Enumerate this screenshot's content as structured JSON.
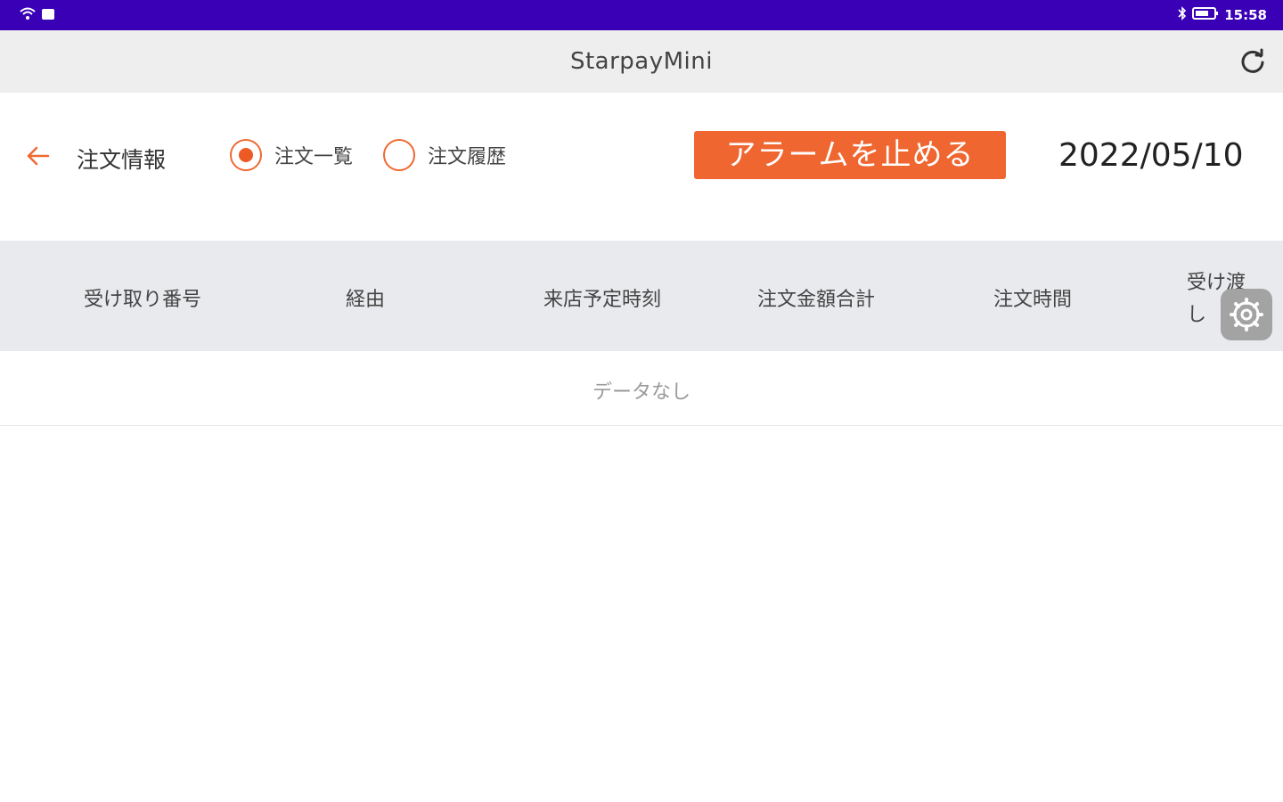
{
  "status_bar": {
    "time": "15:58",
    "icons": [
      "wifi-icon",
      "notification-icon",
      "bluetooth-icon",
      "battery-icon"
    ]
  },
  "app_bar": {
    "title": "StarpayMini",
    "refresh_icon": "refresh-icon"
  },
  "toolbar": {
    "back_icon": "arrow-left-icon",
    "title": "注文情報",
    "radio_options": [
      {
        "label": "注文一覧",
        "selected": true
      },
      {
        "label": "注文履歴",
        "selected": false
      }
    ],
    "alarm_button_label": "アラームを止める",
    "date": "2022/05/10"
  },
  "table": {
    "columns": [
      "受け取り番号",
      "経由",
      "来店予定時刻",
      "注文金額合計",
      "注文時間",
      "受け渡し"
    ],
    "empty_text": "データなし"
  },
  "floating": {
    "gear_icon": "gear-icon"
  },
  "colors": {
    "status_bar": "#3a00b6",
    "accent": "#ef6630",
    "header_bg": "#e8eaed",
    "app_bar_bg": "#eeeeee"
  }
}
